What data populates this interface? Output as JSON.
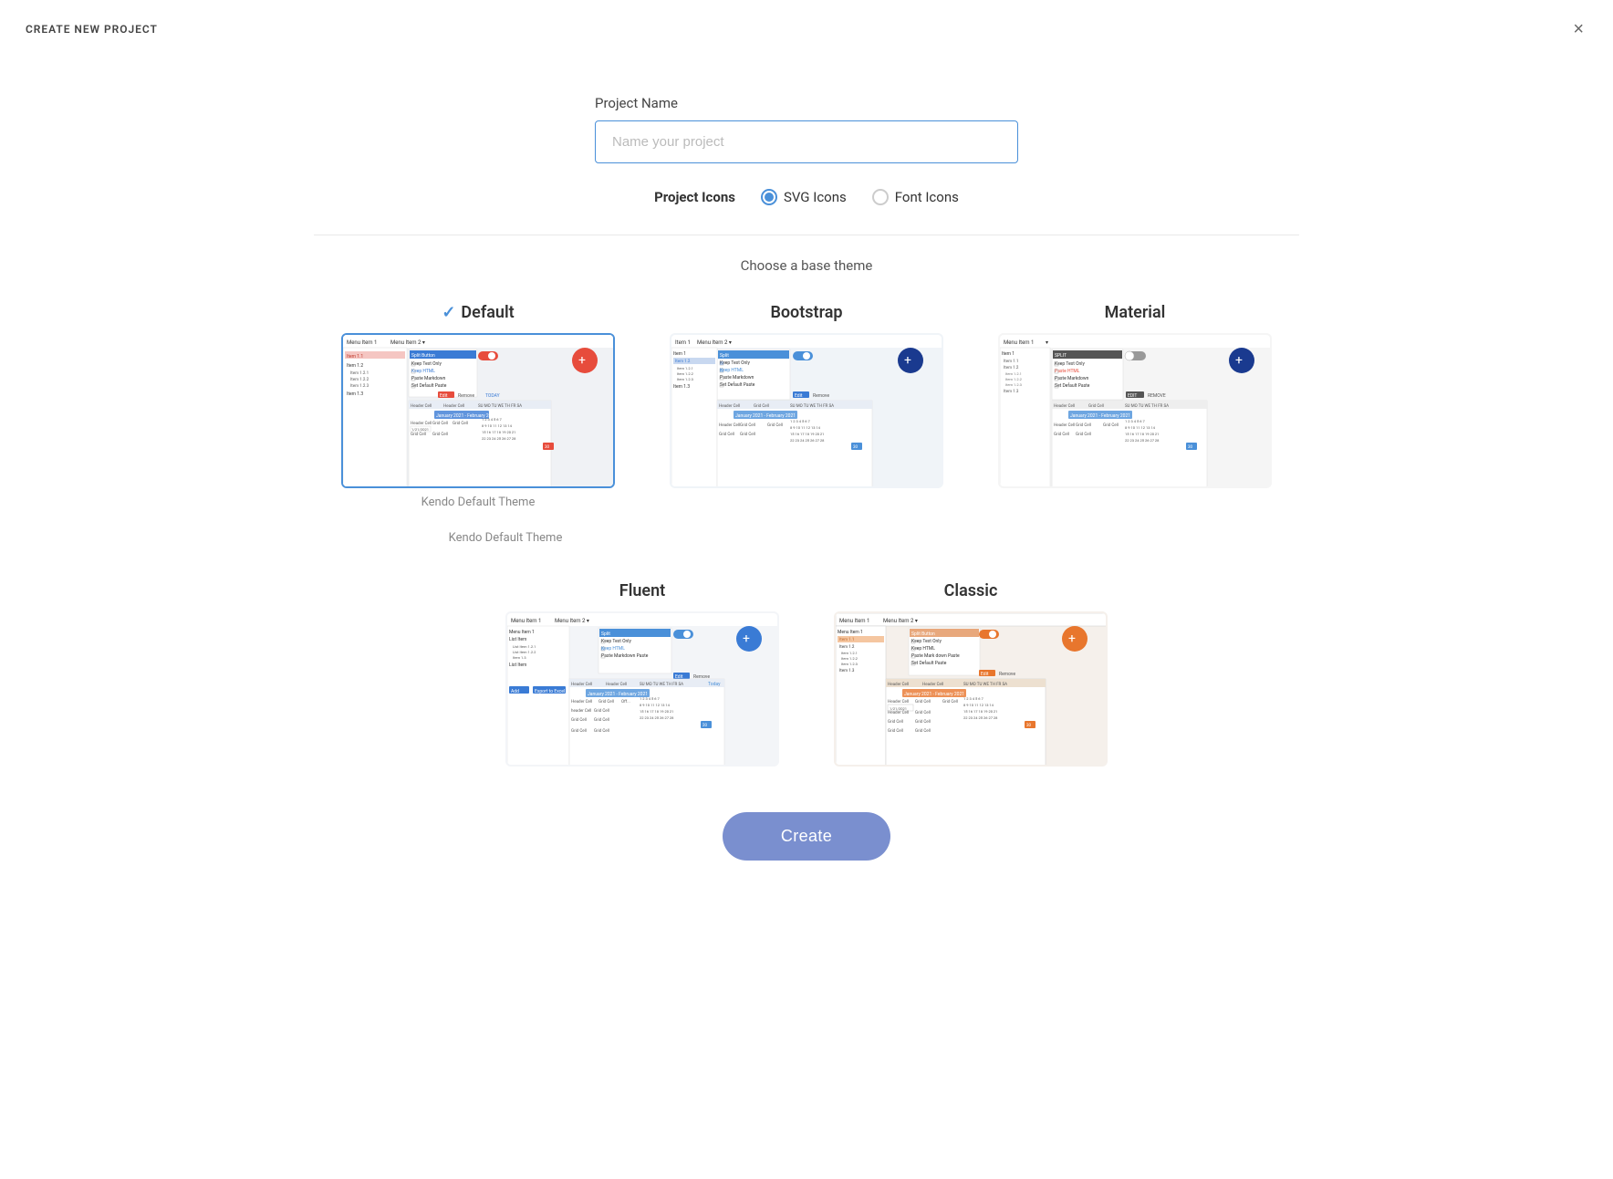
{
  "header": {
    "title": "CREATE NEW PROJECT",
    "close_label": "×"
  },
  "form": {
    "project_name_label": "Project Name",
    "project_name_placeholder": "Name your project",
    "project_icons_label": "Project Icons",
    "svg_icons_label": "SVG Icons",
    "font_icons_label": "Font Icons",
    "svg_selected": true
  },
  "themes": {
    "section_title": "Choose a base theme",
    "items": [
      {
        "id": "default",
        "name": "Default",
        "selected": true,
        "caption": "Kendo Default Theme",
        "check": "✓"
      },
      {
        "id": "bootstrap",
        "name": "Bootstrap",
        "selected": false,
        "caption": ""
      },
      {
        "id": "material",
        "name": "Material",
        "selected": false,
        "caption": ""
      },
      {
        "id": "fluent",
        "name": "Fluent",
        "selected": false,
        "caption": ""
      },
      {
        "id": "classic",
        "name": "Classic",
        "selected": false,
        "caption": ""
      }
    ]
  },
  "buttons": {
    "create_label": "Create"
  }
}
